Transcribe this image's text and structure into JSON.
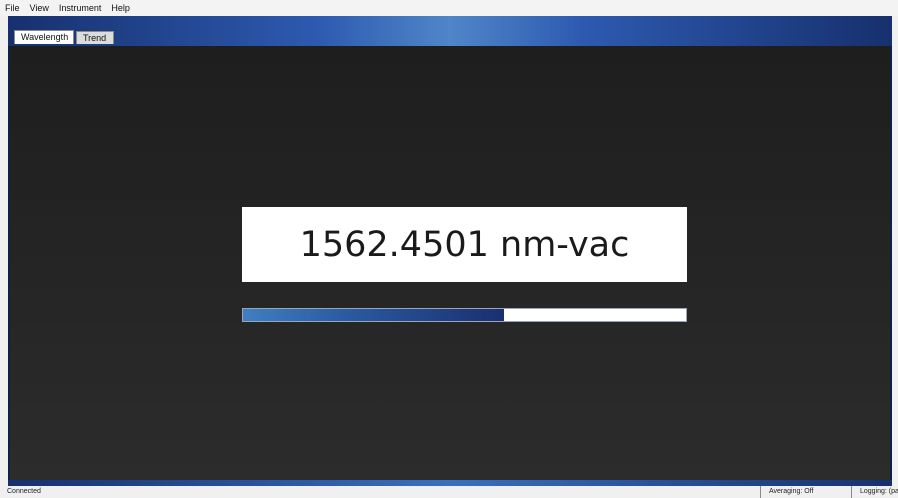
{
  "menu": {
    "file": "File",
    "view": "View",
    "instrument": "Instrument",
    "help": "Help"
  },
  "tabs": {
    "wavelength": "Wavelength",
    "trend": "Trend"
  },
  "reading": {
    "value": "1562.4501 nm-vac"
  },
  "signal": {
    "level_fraction": 0.59
  },
  "status": {
    "connection": "Connected",
    "averaging": "Averaging: Off",
    "logging": "Logging: (partially visible)"
  },
  "colors": {
    "accent_blue": "#2d5ab0",
    "content_bg": "#262626",
    "signal_fill": "#1a2f70"
  }
}
